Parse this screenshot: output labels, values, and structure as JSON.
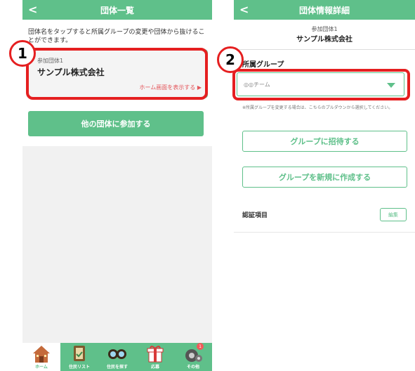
{
  "left": {
    "header_title": "団体一覧",
    "back_glyph": "<",
    "description": "団体名をタップすると所属グループの変更や団体から抜けることができます。",
    "org_card": {
      "small_label": "参加団体1",
      "name": "サンプル株式会社",
      "link_text": "ホーム画面を表示する ▶"
    },
    "join_button": "他の団体に参加する",
    "tabs": [
      {
        "label": "ホーム",
        "icon": "home-icon"
      },
      {
        "label": "住民リスト",
        "icon": "book-icon"
      },
      {
        "label": "住民を探す",
        "icon": "binoculars-icon"
      },
      {
        "label": "応募",
        "icon": "gift-icon"
      },
      {
        "label": "その他",
        "icon": "gear-icon",
        "badge": "1"
      }
    ]
  },
  "callouts": {
    "one": "1",
    "two": "2"
  },
  "right": {
    "header_title": "団体情報詳細",
    "back_glyph": "<",
    "org_small": "参加団体1",
    "org_name": "サンプル株式会社",
    "group_label": "所属グループ",
    "select_value": "◎◎チーム",
    "note": "※所属グループを変更する場合は、こちらのプルダウンから選択してください。",
    "invite_button": "グループに招待する",
    "create_button": "グループを新規に作成する",
    "auth_label": "認証項目",
    "edit_button": "編集"
  },
  "colors": {
    "accent": "#5fc08a",
    "highlight": "#e51f20",
    "link": "#e4555a"
  }
}
